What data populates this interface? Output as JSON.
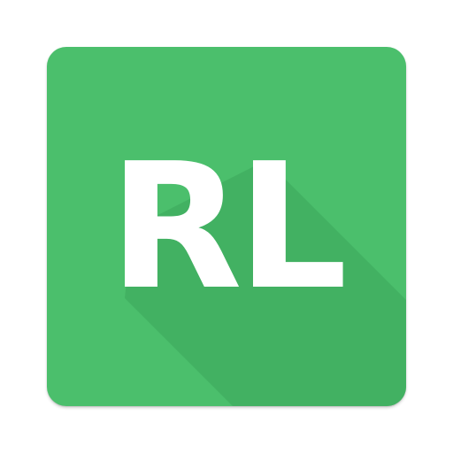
{
  "icon": {
    "text": "RL",
    "background_color": "#4bbf6c",
    "text_color": "#ffffff",
    "shadow_color": "#3fa85d"
  }
}
